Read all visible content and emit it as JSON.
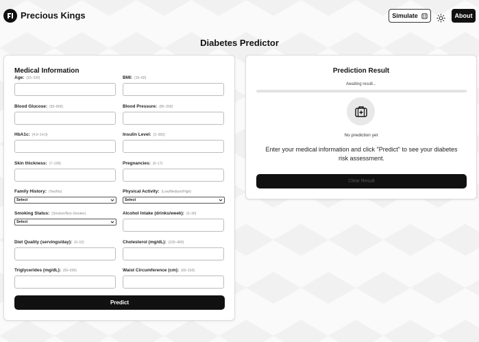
{
  "header": {
    "brand": "Precious Kings",
    "logo_icon": "brand-logo-icon",
    "simulate_label": "Simulate",
    "simulate_icon": "dice-icon",
    "theme_icon": "sun-icon",
    "about_label": "About"
  },
  "page_title": "Diabetes Predictor",
  "form": {
    "section_title": "Medical Information",
    "fields": [
      {
        "label": "Age:",
        "range": "(10–100)"
      },
      {
        "label": "BMI:",
        "range": "(10–60)"
      },
      {
        "label": "Blood Glucose:",
        "range": "(50–800)"
      },
      {
        "label": "Blood Pressure:",
        "range": "(80–200)"
      },
      {
        "label": "HbA1c:",
        "range": "(4.0–14.0)"
      },
      {
        "label": "Insulin Level:",
        "range": "(2–300)"
      },
      {
        "label": "Skin thickness:",
        "range": "(7–100)"
      },
      {
        "label": "Pregnancies:",
        "range": "(0–17)"
      },
      {
        "label": "Family History:",
        "range": "(Yes/No)",
        "value": "Select"
      },
      {
        "label": "Physical Activity:",
        "range": "(Low/Medium/High)",
        "value": "Select"
      },
      {
        "label": "Smoking Status:",
        "range": "(Smoker/Non-Smoker)",
        "value": "Select"
      },
      {
        "label": "Alcohol Intake (drinks/week):",
        "range": "(0–30)"
      },
      {
        "label": "Diet Quality (servings/day):",
        "range": "(0–10)"
      },
      {
        "label": "Cholesterol (mg/dL):",
        "range": "(100–400)"
      },
      {
        "label": "Triglycerides (mg/dL):",
        "range": "(50–500)"
      },
      {
        "label": "Waist Circumference (cm):",
        "range": "(60–150)"
      }
    ],
    "predict_label": "Predict"
  },
  "result": {
    "title": "Prediction Result",
    "status": "Awaiting result...",
    "icon": "medical-kit-icon",
    "no_prediction": "No prediction yet",
    "instruction": "Enter your medical information and click \"Predict\" to see your diabetes risk assessment.",
    "clear_label": "Clear Result"
  },
  "colors": {
    "primary": "#111111",
    "border": "#bbbbbb",
    "background": "#fafafa"
  }
}
